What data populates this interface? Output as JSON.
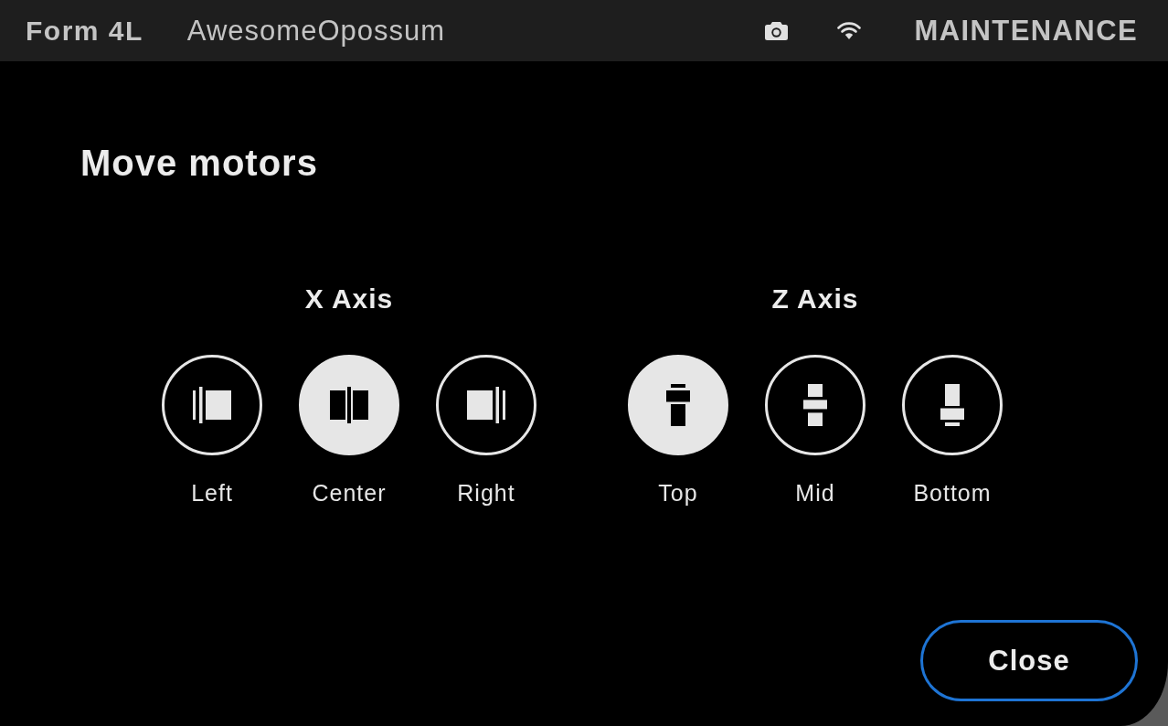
{
  "status_bar": {
    "printer_model": "Form 4L",
    "printer_name": "AwesomeOpossum",
    "mode": "MAINTENANCE"
  },
  "title": "Move motors",
  "axes": [
    {
      "title": "X Axis",
      "positions": [
        {
          "label": "Left",
          "kind": "left",
          "selected": false
        },
        {
          "label": "Center",
          "kind": "center",
          "selected": true
        },
        {
          "label": "Right",
          "kind": "right",
          "selected": false
        }
      ]
    },
    {
      "title": "Z Axis",
      "positions": [
        {
          "label": "Top",
          "kind": "top",
          "selected": true
        },
        {
          "label": "Mid",
          "kind": "mid",
          "selected": false
        },
        {
          "label": "Bottom",
          "kind": "bottom",
          "selected": false
        }
      ]
    }
  ],
  "close_button": {
    "label": "Close"
  }
}
